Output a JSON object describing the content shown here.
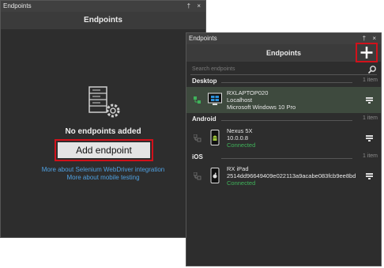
{
  "left_panel": {
    "window_title": "Endpoints",
    "window_controls": "† ×",
    "header": "Endpoints",
    "empty_message": "No endpoints added",
    "add_button_label": "Add endpoint",
    "link_selenium": "More about Selenium WebDriver integration",
    "link_mobile": "More about mobile testing"
  },
  "right_panel": {
    "window_title": "Endpoints",
    "window_controls": "† ×",
    "header": "Endpoints",
    "search_placeholder": "Search endpoints",
    "groups": [
      {
        "name": "Desktop",
        "count": "1 item",
        "endpoint": {
          "name": "RXLAPTOP020",
          "line2": "Localhost",
          "line3": "Microsoft Windows 10 Pro",
          "os": "windows-icon",
          "selected": true
        }
      },
      {
        "name": "Android",
        "count": "1 item",
        "endpoint": {
          "name": "Nexus 5X",
          "line2": "10.0.0.8",
          "line3": "Connected",
          "os": "android-icon",
          "selected": false
        }
      },
      {
        "name": "iOS",
        "count": "1 item",
        "endpoint": {
          "name": "RX iPad",
          "line2": "2514dd96649409e022113a9acabe083fcb9ee8bd",
          "line3": "Connected",
          "os": "apple-icon",
          "selected": false
        }
      }
    ]
  },
  "colors": {
    "accent_highlight": "#d1111b",
    "link": "#4fa0e0",
    "connected": "#3fb25a",
    "panel_bg": "#2d2d2d",
    "header_bg": "#3b3b3b"
  }
}
